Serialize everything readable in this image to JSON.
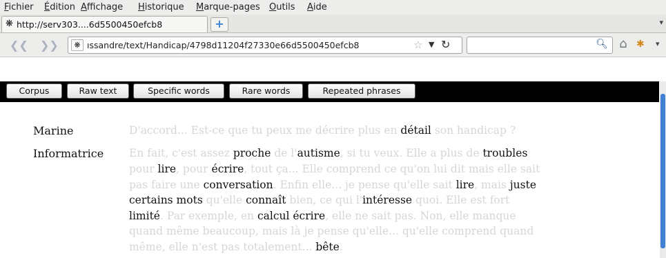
{
  "menu": [
    "Fichier",
    "Édition",
    "Affichage",
    "Historique",
    "Marque-pages",
    "Outils",
    "Aide"
  ],
  "tab": {
    "title": "http://serv303....6d5500450efcb8",
    "new_tab_label": "+"
  },
  "navbar": {
    "url": "ıssandre/text/Handicap/4798d11204f27330e66d5500450efcb8",
    "search_value": ""
  },
  "toolbar": {
    "buttons": [
      "Corpus",
      "Raw text",
      "Specific words",
      "Rare words",
      "Repeated phrases"
    ]
  },
  "dialogue": {
    "speakers": [
      "Marine",
      "Informatrice"
    ],
    "lines": [
      [
        {
          "t": "D'accord... ",
          "c": "g"
        },
        {
          "t": "Est-ce que tu ",
          "c": "g"
        },
        {
          "t": "peux",
          "c": "g"
        },
        {
          "t": " me ",
          "c": "g"
        },
        {
          "t": "décrire",
          "c": "g"
        },
        {
          "t": " plus en ",
          "c": "g"
        },
        {
          "t": "détail",
          "c": "w"
        },
        {
          "t": " son handicap ?",
          "c": "g"
        }
      ],
      [
        {
          "t": "En fait, c'est ",
          "c": "g"
        },
        {
          "t": "assez ",
          "c": "g"
        },
        {
          "t": "proche",
          "c": "w"
        },
        {
          "t": " de l'",
          "c": "g"
        },
        {
          "t": "autisme",
          "c": "w"
        },
        {
          "t": ", si tu ",
          "c": "g"
        },
        {
          "t": "veux",
          "c": "g"
        },
        {
          "t": ". Elle a plus de ",
          "c": "g"
        },
        {
          "t": "troubles",
          "c": "w"
        }
      ],
      [
        {
          "t": "pour ",
          "c": "g"
        },
        {
          "t": "lire",
          "c": "w"
        },
        {
          "t": ", pour ",
          "c": "g"
        },
        {
          "t": "écrire",
          "c": "w"
        },
        {
          "t": ", tout ça... Elle ",
          "c": "g"
        },
        {
          "t": "comprend",
          "c": "g"
        },
        {
          "t": " ce qu'on lui dit mais elle ",
          "c": "g"
        },
        {
          "t": "sait",
          "c": "g"
        }
      ],
      [
        {
          "t": "pas ",
          "c": "g"
        },
        {
          "t": "faire",
          "c": "g"
        },
        {
          "t": " une ",
          "c": "g"
        },
        {
          "t": "conversation",
          "c": "w"
        },
        {
          "t": ". Enfin elle... je pense qu'elle ",
          "c": "g"
        },
        {
          "t": "sait",
          "c": "g"
        },
        {
          "t": " ",
          "c": "g"
        },
        {
          "t": "lire",
          "c": "w"
        },
        {
          "t": ", mais ",
          "c": "g"
        },
        {
          "t": "juste",
          "c": "w"
        }
      ],
      [
        {
          "t": "certains mots",
          "c": "w"
        },
        {
          "t": " qu'elle ",
          "c": "g"
        },
        {
          "t": "connaît",
          "c": "w"
        },
        {
          "t": " bien, ce qui l'",
          "c": "g"
        },
        {
          "t": "intéresse",
          "c": "w"
        },
        {
          "t": " quoi. Elle est ",
          "c": "g"
        },
        {
          "t": "fort",
          "c": "g"
        }
      ],
      [
        {
          "t": "limité",
          "c": "w"
        },
        {
          "t": ". Par exemple, en ",
          "c": "g"
        },
        {
          "t": "calcul",
          "c": "w"
        },
        {
          "t": " ",
          "c": "g"
        },
        {
          "t": "écrire",
          "c": "w"
        },
        {
          "t": ", elle ne ",
          "c": "g"
        },
        {
          "t": "sait",
          "c": "g"
        },
        {
          "t": " pas. Non, elle ",
          "c": "g"
        },
        {
          "t": "manque",
          "c": "g"
        }
      ],
      [
        {
          "t": "quand même beaucoup",
          "c": "g"
        },
        {
          "t": ", mais là je pense qu'elle... qu'elle ",
          "c": "g"
        },
        {
          "t": "comprend",
          "c": "g"
        },
        {
          "t": " quand",
          "c": "g"
        }
      ],
      [
        {
          "t": "même, elle n'est pas ",
          "c": "g"
        },
        {
          "t": "totalement",
          "c": "g"
        },
        {
          "t": "... ",
          "c": "g"
        },
        {
          "t": "bête",
          "c": "w"
        },
        {
          "t": ".",
          "c": "g"
        }
      ]
    ]
  }
}
